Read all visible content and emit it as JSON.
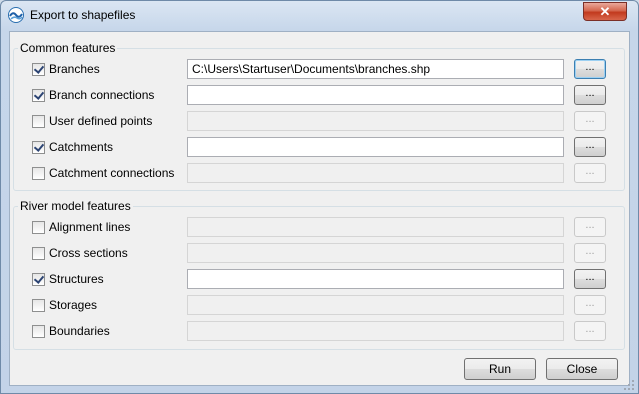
{
  "window": {
    "title": "Export to shapefiles",
    "close_glyph": "✕"
  },
  "common": {
    "label": "Common features",
    "rows": [
      {
        "label": "Branches",
        "checked": true,
        "path": "C:\\Users\\Startuser\\Documents\\branches.shp",
        "enabled": true,
        "browse": "..."
      },
      {
        "label": "Branch connections",
        "checked": true,
        "path": "",
        "enabled": true,
        "browse": "..."
      },
      {
        "label": "User defined points",
        "checked": false,
        "path": "",
        "enabled": false,
        "browse": "..."
      },
      {
        "label": "Catchments",
        "checked": true,
        "path": "",
        "enabled": true,
        "browse": "..."
      },
      {
        "label": "Catchment connections",
        "checked": false,
        "path": "",
        "enabled": false,
        "browse": "..."
      }
    ]
  },
  "river": {
    "label": "River model features",
    "rows": [
      {
        "label": "Alignment lines",
        "checked": false,
        "path": "",
        "enabled": false,
        "browse": "..."
      },
      {
        "label": "Cross sections",
        "checked": false,
        "path": "",
        "enabled": false,
        "browse": "..."
      },
      {
        "label": "Structures",
        "checked": true,
        "path": "",
        "enabled": true,
        "browse": "..."
      },
      {
        "label": "Storages",
        "checked": false,
        "path": "",
        "enabled": false,
        "browse": "..."
      },
      {
        "label": "Boundaries",
        "checked": false,
        "path": "",
        "enabled": false,
        "browse": "..."
      }
    ]
  },
  "footer": {
    "run_label": "Run",
    "close_label": "Close"
  }
}
